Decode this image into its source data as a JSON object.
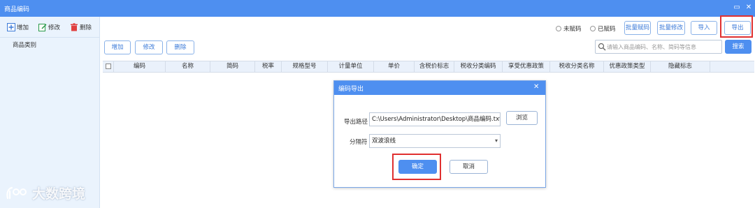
{
  "window": {
    "title": "商品编码",
    "maximize_icon": "maximize-icon",
    "close_icon": "close-icon"
  },
  "left_toolbar": {
    "add_label": "增加",
    "edit_label": "修改",
    "delete_label": "删除"
  },
  "category_label": "商品类别",
  "filters": {
    "unassigned": "未赋码",
    "assigned": "已赋码"
  },
  "top_buttons": {
    "batch_assign": "批量赋码",
    "batch_edit": "批量修改",
    "import": "导入",
    "export": "导出"
  },
  "grid_toolbar": {
    "add": "增加",
    "edit": "修改",
    "delete": "删除"
  },
  "search": {
    "placeholder": "请输入商品编码、名称、简码等信息",
    "button": "搜索"
  },
  "table": {
    "columns": [
      "编码",
      "名称",
      "简码",
      "税率",
      "规格型号",
      "计量单位",
      "单价",
      "含税价标志",
      "税收分类编码",
      "享受优惠政策",
      "税收分类名称",
      "优惠政策类型",
      "隐藏标志"
    ]
  },
  "dialog": {
    "title": "编码导出",
    "path_label": "导出路径",
    "path_value": "C:\\Users\\Administrator\\Desktop\\商品编码.txt",
    "browse": "浏览",
    "separator_label": "分隔符",
    "separator_value": "双波浪线",
    "confirm": "确定",
    "cancel": "取消"
  },
  "watermark": {
    "text": "大数跨境"
  },
  "colors": {
    "accent": "#4e8ff0",
    "highlight": "#e03030",
    "panel_bg": "#eaf3fd"
  }
}
